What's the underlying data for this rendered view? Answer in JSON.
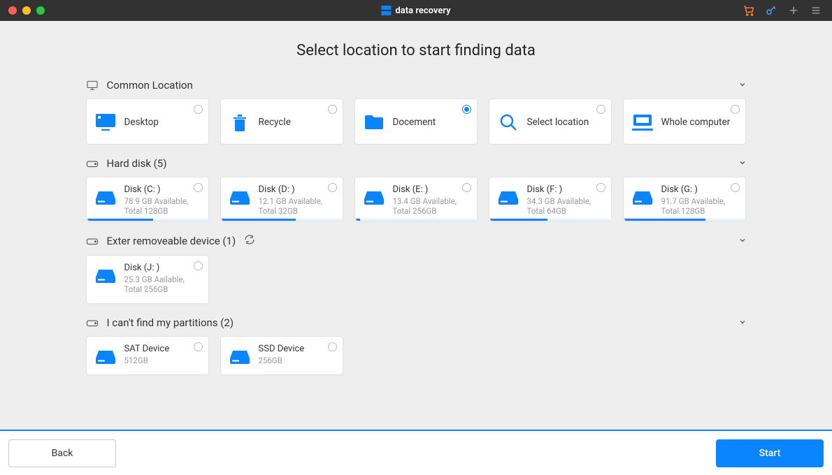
{
  "titlebar": {
    "app_title": "data recovery"
  },
  "heading": "Select location to  start finding data",
  "sections": {
    "common": {
      "title": "Common Location",
      "items": [
        {
          "label": "Desktop",
          "icon": "desktop",
          "selected": false
        },
        {
          "label": "Recycle",
          "icon": "recycle",
          "selected": false
        },
        {
          "label": "Docement",
          "icon": "document",
          "selected": true
        },
        {
          "label": "Select location",
          "icon": "search",
          "selected": false
        },
        {
          "label": "Whole computer",
          "icon": "computer",
          "selected": false
        }
      ]
    },
    "harddisk": {
      "title": "Hard disk (5)",
      "items": [
        {
          "title": "Disk (C: )",
          "sub": "78.9 GB Available, Total 128GB",
          "used_pct": 55
        },
        {
          "title": "Disk (D: )",
          "sub": "12.1 GB Available, Total 32GB",
          "used_pct": 62
        },
        {
          "title": "Disk (E: )",
          "sub": "13.4 GB Available, Total 256GB",
          "used_pct": 4
        },
        {
          "title": "Disk (F: )",
          "sub": "34.3 GB Available, Total 64GB",
          "used_pct": 48
        },
        {
          "title": "Disk (G: )",
          "sub": "91.7 GB Available, Total 128GB",
          "used_pct": 68
        }
      ]
    },
    "external": {
      "title": "Exter removeable device (1)",
      "items": [
        {
          "title": "Disk (J: )",
          "sub": "25.3 GB Aailable, Total 256GB"
        }
      ]
    },
    "partitions": {
      "title": "I can't find my partitions (2)",
      "items": [
        {
          "title": "SAT Device",
          "sub": "512GB"
        },
        {
          "title": "SSD Device",
          "sub": "256GB"
        }
      ]
    }
  },
  "footer": {
    "back": "Back",
    "start": "Start"
  }
}
